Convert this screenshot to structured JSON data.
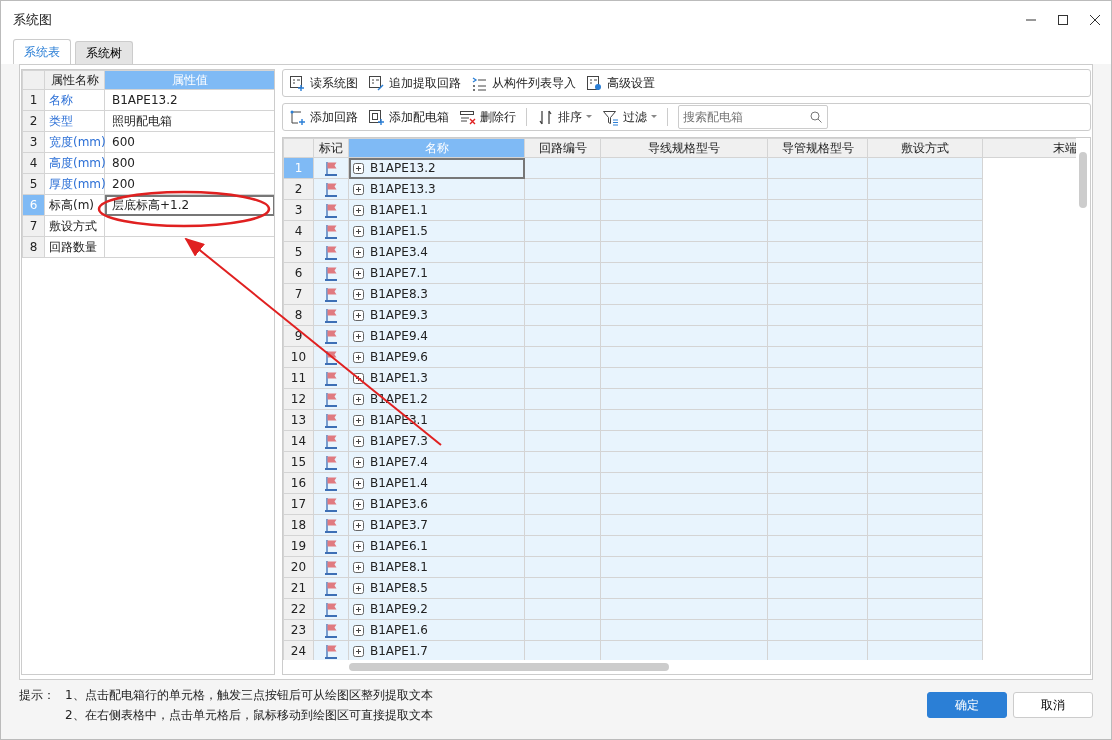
{
  "window": {
    "title": "系统图"
  },
  "tabs": [
    {
      "label": "系统表",
      "selected": true
    },
    {
      "label": "系统树",
      "selected": false
    }
  ],
  "properties": {
    "columns": [
      {
        "label": "属性名称",
        "selected": false
      },
      {
        "label": "属性值",
        "selected": true
      }
    ],
    "rows": [
      {
        "num": "1",
        "name": "名称",
        "value": "B1APE13.2",
        "link": true,
        "selected": false
      },
      {
        "num": "2",
        "name": "类型",
        "value": "照明配电箱",
        "link": true,
        "selected": false
      },
      {
        "num": "3",
        "name": "宽度(mm)",
        "value": "600",
        "link": true,
        "selected": false
      },
      {
        "num": "4",
        "name": "高度(mm)",
        "value": "800",
        "link": true,
        "selected": false
      },
      {
        "num": "5",
        "name": "厚度(mm)",
        "value": "200",
        "link": true,
        "selected": false
      },
      {
        "num": "6",
        "name": "标高(m)",
        "value": "层底标高+1.2",
        "link": false,
        "selected": true
      },
      {
        "num": "7",
        "name": "敷设方式",
        "value": "",
        "link": false,
        "selected": false
      },
      {
        "num": "8",
        "name": "回路数量",
        "value": "",
        "link": false,
        "selected": false
      }
    ]
  },
  "toolbar_top": [
    {
      "label": "读系统图",
      "kind": "read"
    },
    {
      "label": "追加提取回路",
      "kind": "append"
    },
    {
      "label": "从构件列表导入",
      "kind": "import"
    },
    {
      "label": "高级设置",
      "kind": "settings"
    }
  ],
  "toolbar_edit": [
    {
      "label": "添加回路",
      "kind": "add-loop",
      "dropdown": false
    },
    {
      "label": "添加配电箱",
      "kind": "add-box",
      "dropdown": false
    },
    {
      "label": "删除行",
      "kind": "delete",
      "dropdown": false
    },
    {
      "label": "排序",
      "kind": "sort",
      "dropdown": true
    },
    {
      "label": "过滤",
      "kind": "filter",
      "dropdown": true
    }
  ],
  "search": {
    "placeholder": "搜索配电箱"
  },
  "grid": {
    "columns": [
      {
        "label": "标记",
        "selected": false
      },
      {
        "label": "名称",
        "selected": true
      },
      {
        "label": "回路编号",
        "selected": false
      },
      {
        "label": "导线规格型号",
        "selected": false
      },
      {
        "label": "导管规格型号",
        "selected": false
      },
      {
        "label": "敷设方式",
        "selected": false
      },
      {
        "label": "末端",
        "selected": false
      }
    ],
    "rows": [
      {
        "num": "1",
        "name": "B1APE13.2",
        "selected": true
      },
      {
        "num": "2",
        "name": "B1APE13.3",
        "selected": false
      },
      {
        "num": "3",
        "name": "B1APE1.1",
        "selected": false
      },
      {
        "num": "4",
        "name": "B1APE1.5",
        "selected": false
      },
      {
        "num": "5",
        "name": "B1APE3.4",
        "selected": false
      },
      {
        "num": "6",
        "name": "B1APE7.1",
        "selected": false
      },
      {
        "num": "7",
        "name": "B1APE8.3",
        "selected": false
      },
      {
        "num": "8",
        "name": "B1APE9.3",
        "selected": false
      },
      {
        "num": "9",
        "name": "B1APE9.4",
        "selected": false
      },
      {
        "num": "10",
        "name": "B1APE9.6",
        "selected": false
      },
      {
        "num": "11",
        "name": "B1APE1.3",
        "selected": false
      },
      {
        "num": "12",
        "name": "B1APE1.2",
        "selected": false
      },
      {
        "num": "13",
        "name": "B1APE3.1",
        "selected": false
      },
      {
        "num": "14",
        "name": "B1APE7.3",
        "selected": false
      },
      {
        "num": "15",
        "name": "B1APE7.4",
        "selected": false
      },
      {
        "num": "16",
        "name": "B1APE1.4",
        "selected": false
      },
      {
        "num": "17",
        "name": "B1APE3.6",
        "selected": false
      },
      {
        "num": "18",
        "name": "B1APE3.7",
        "selected": false
      },
      {
        "num": "19",
        "name": "B1APE6.1",
        "selected": false
      },
      {
        "num": "20",
        "name": "B1APE8.1",
        "selected": false
      },
      {
        "num": "21",
        "name": "B1APE8.5",
        "selected": false
      },
      {
        "num": "22",
        "name": "B1APE9.2",
        "selected": false
      },
      {
        "num": "23",
        "name": "B1APE1.6",
        "selected": false
      },
      {
        "num": "24",
        "name": "B1APE1.7",
        "selected": false
      }
    ]
  },
  "hints": {
    "label": "提示：",
    "lines": [
      "1、点击配电箱行的单元格，触发三点按钮后可从绘图区整列提取文本",
      "2、在右侧表格中，点击单元格后，鼠标移动到绘图区可直接提取文本"
    ]
  },
  "buttons": [
    {
      "label": "确定",
      "primary": true
    },
    {
      "label": "取消",
      "primary": false
    }
  ]
}
